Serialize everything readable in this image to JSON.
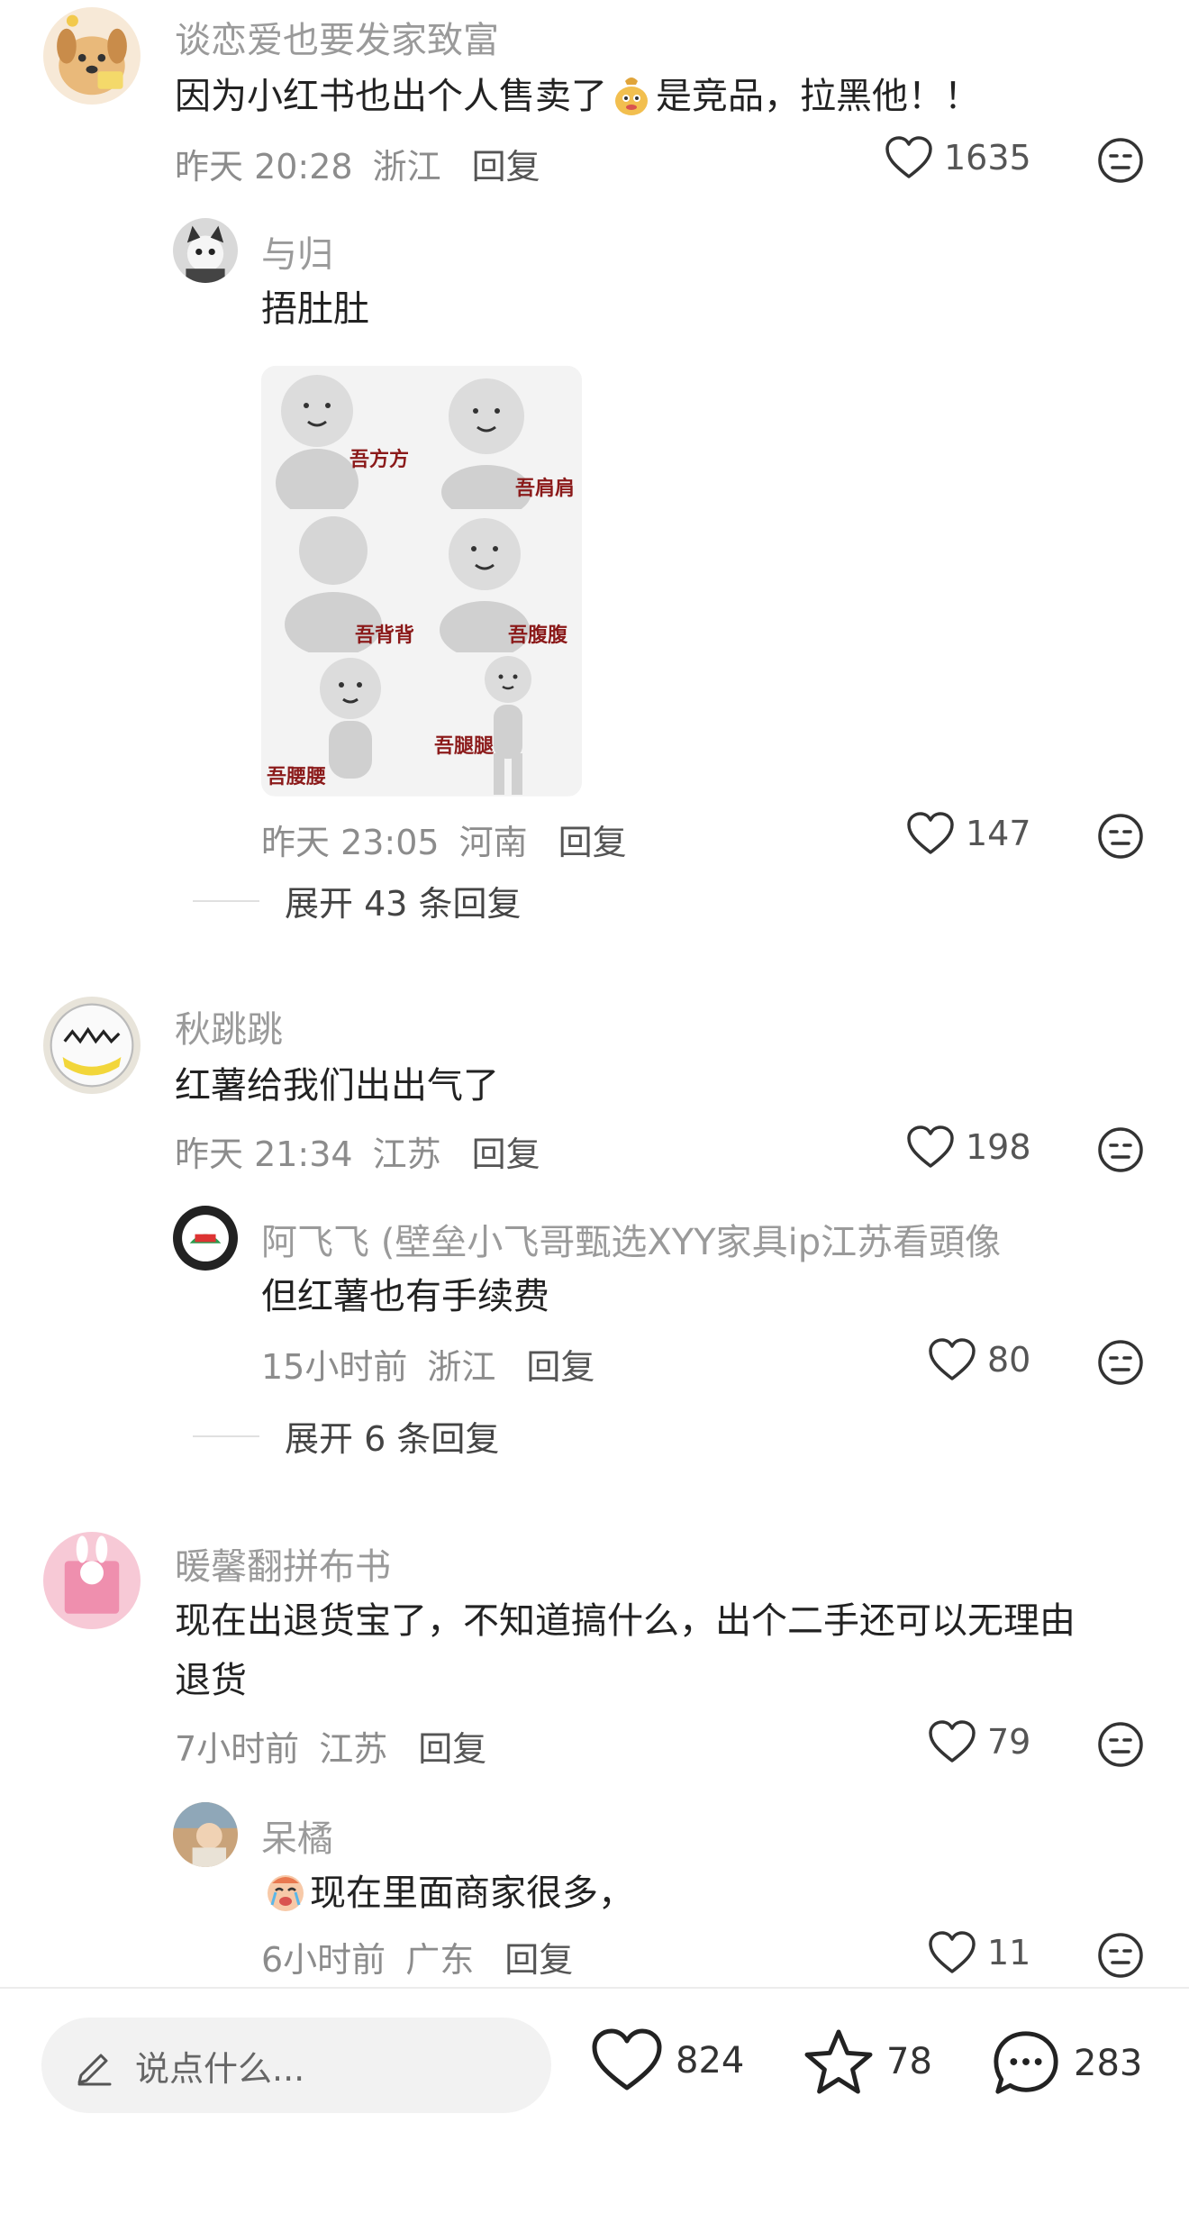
{
  "comments": [
    {
      "author": "谈恋爱也要发家致富",
      "text_before": "因为小红书也出个人售卖了",
      "text_after": "是竞品，拉黑他！！",
      "time": "昨天 20:28",
      "location": "浙江",
      "reply_label": "回复",
      "likes": "1635",
      "replies": [
        {
          "author": "与归",
          "text": "捂肚肚",
          "sticker_captions": [
            "吾方方",
            "吾肩肩",
            "吾背背",
            "吾腹腹",
            "吾腰腰",
            "吾腿腿"
          ],
          "time": "昨天 23:05",
          "location": "河南",
          "reply_label": "回复",
          "likes": "147"
        }
      ],
      "expand_label": "展开 43 条回复"
    },
    {
      "author": "秋跳跳",
      "text": "红薯给我们出出气了",
      "time": "昨天 21:34",
      "location": "江苏",
      "reply_label": "回复",
      "likes": "198",
      "replies": [
        {
          "author": "阿飞飞 (壁垒小飞哥甄选XYY家具ip江苏看頭像",
          "text": "但红薯也有手续费",
          "time": "15小时前",
          "location": "浙江",
          "reply_label": "回复",
          "likes": "80"
        }
      ],
      "expand_label": "展开 6 条回复"
    },
    {
      "author": "暖馨翻拼布书",
      "text_line1": "现在出退货宝了，不知道搞什么，出个二手还可以无理由",
      "text_line2": "退货",
      "time": "7小时前",
      "location": "江苏",
      "reply_label": "回复",
      "likes": "79",
      "replies": [
        {
          "author": "呆橘",
          "text": "现在里面商家很多，",
          "time": "6小时前",
          "location": "广东",
          "reply_label": "回复",
          "likes": "11"
        }
      ]
    }
  ],
  "bottom_bar": {
    "input_placeholder": "说点什么...",
    "likes": "824",
    "favorites": "78",
    "comments": "283"
  },
  "icons": {
    "like": "heart-outline-icon",
    "dislike": "neutral-face-icon",
    "edit": "pencil-icon",
    "favorite": "star-outline-icon",
    "comment": "speech-bubble-icon"
  }
}
